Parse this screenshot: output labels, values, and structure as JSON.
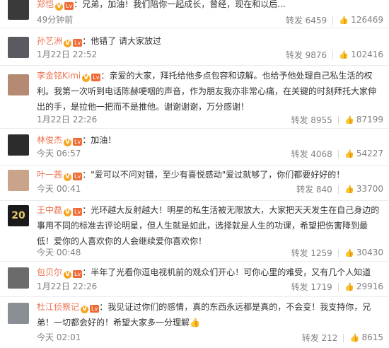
{
  "comments": [
    {
      "user": "郑恺",
      "level": "Lv",
      "text": "：兄弟，加油！我们陪你一起成长，曾经，现在和以后...",
      "time": "49分钟前",
      "repost": "转发 6459",
      "likes": "126469",
      "thumb_icon": "thumbs-up-icon",
      "avatar_color": "#3a3a3a"
    },
    {
      "user": "孙艺洲",
      "level": "Lv",
      "text": "：他错了 请大家放过",
      "time": "1月22日 22:52",
      "repost": "转发 9876",
      "likes": "102416",
      "thumb_icon": "thumbs-up-icon",
      "avatar_color": "#5a5a60"
    },
    {
      "user": "李金铭Kimi",
      "level": "Lv",
      "text": "：亲爱的大家，拜托给他多点包容和谅解。也给予他处理自己私生活的权利。我第一次听到电话陈赫哽咽的声音，作为朋友我亦非常心痛，在关键的时刻拜托大家伸出的手，是拉他一把而不是推他。谢谢谢谢，万分感谢！",
      "time": "1月22日 22:26",
      "repost": "转发 8955",
      "likes": "87199",
      "thumb_icon": "thumbs-up-icon",
      "avatar_color": "#b48a72"
    },
    {
      "user": "林俊杰",
      "level": "Lv",
      "text": "：加油！",
      "time": "今天 06:57",
      "repost": "转发 4068",
      "likes": "54227",
      "thumb_icon": "thumbs-up-icon",
      "avatar_color": "#2c2c2c"
    },
    {
      "user": "叶一茜",
      "level": "Lv",
      "text": "：\"爱可以不问对错，至少有喜悦感动\"爱过就够了，你们都要好好的！",
      "time": "今天 00:41",
      "repost": "转发 840",
      "likes": "33700",
      "thumb_icon": "thumbs-up-icon",
      "avatar_color": "#c9a48a"
    },
    {
      "user": "王中磊",
      "level": "Lv",
      "text": "：光环越大反射越大！明星的私生活被无限放大，大家把天天发生在自己身边的事用不同的标准去评论明星，但人生就是如此，选择就是人生的功课，希望把伤害降到最低！爱你的人喜欢你的人会继续爱你喜欢你！",
      "time": "今天 00:48",
      "repost": "转发 1259",
      "likes": "30430",
      "thumb_icon": "thumbs-up-icon",
      "avatar_color": "#1a1a1a",
      "avatar_text": "20"
    },
    {
      "user": "包贝尔",
      "level": "Lv",
      "text": "：半年了光看你逗电视机前的观众们开心！可你心里的难受，又有几个人知道",
      "time": "1月22日 22:26",
      "repost": "转发 1719",
      "likes": "29916",
      "thumb_icon": "thumbs-up-icon",
      "avatar_color": "#6b6b6b"
    },
    {
      "user": "杜江侦察记",
      "level": "Lv",
      "text": "：我见证过你们的感情，真的东西永远都是真的，不会变！我支持你，兄弟！一切都会好的！希望大家多一分理解👍",
      "time": "今天 02:01",
      "repost": "转发 212",
      "likes": "8615",
      "thumb_icon": "thumbs-up-icon",
      "avatar_color": "#8a8f95"
    }
  ],
  "colors": {
    "username": "#eb7350",
    "text": "#333333",
    "meta": "#808080",
    "border": "#ececec",
    "badge": "#f6a623"
  }
}
